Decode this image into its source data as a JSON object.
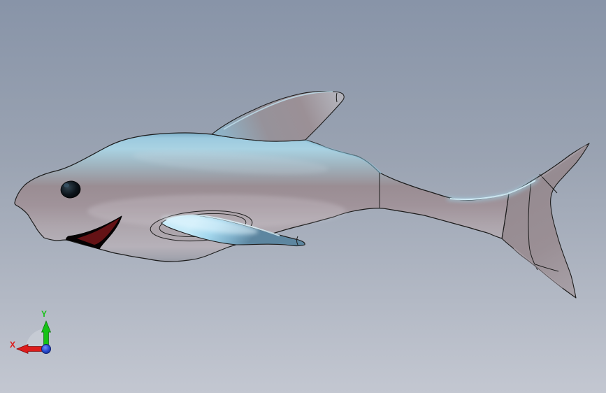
{
  "viewport": {
    "type": "cad-3d-viewport",
    "model": "cartoon-shark-solid-model",
    "background_top_color": "#8894a8",
    "background_bottom_color": "#c3c7d1"
  },
  "model": {
    "body_top_color": "#a9d2e2",
    "body_mid_color": "#9a8d93",
    "body_belly_color": "#b6b1b9",
    "pectoral_fin_color": "#a5d8ee",
    "dorsal_fin_color": "#9b9096",
    "tail_color": "#998e94",
    "mouth_color": "#641215",
    "eye_color": "#0d151c",
    "edge_line_color": "#1c1c1c"
  },
  "triad": {
    "x_label": "X",
    "y_label": "Y",
    "x_axis_color": "#dc1c1c",
    "y_axis_color": "#16c216",
    "z_hub_color": "#2547cc",
    "sector_color": "#ccd0d9"
  }
}
